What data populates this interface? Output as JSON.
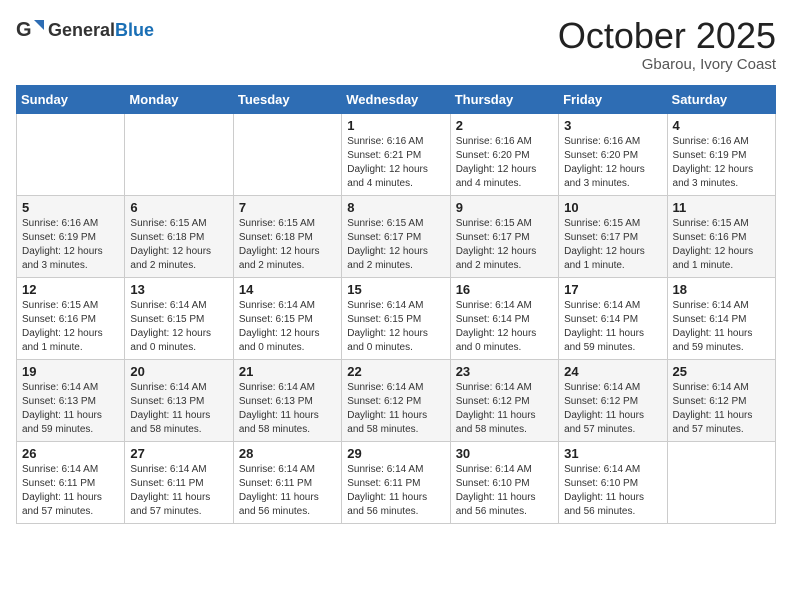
{
  "logo": {
    "general": "General",
    "blue": "Blue"
  },
  "title": "October 2025",
  "subtitle": "Gbarou, Ivory Coast",
  "days_of_week": [
    "Sunday",
    "Monday",
    "Tuesday",
    "Wednesday",
    "Thursday",
    "Friday",
    "Saturday"
  ],
  "weeks": [
    [
      null,
      null,
      null,
      {
        "day": 1,
        "sunrise": "6:16 AM",
        "sunset": "6:21 PM",
        "daylight": "12 hours and 4 minutes."
      },
      {
        "day": 2,
        "sunrise": "6:16 AM",
        "sunset": "6:20 PM",
        "daylight": "12 hours and 4 minutes."
      },
      {
        "day": 3,
        "sunrise": "6:16 AM",
        "sunset": "6:20 PM",
        "daylight": "12 hours and 3 minutes."
      },
      {
        "day": 4,
        "sunrise": "6:16 AM",
        "sunset": "6:19 PM",
        "daylight": "12 hours and 3 minutes."
      }
    ],
    [
      {
        "day": 5,
        "sunrise": "6:16 AM",
        "sunset": "6:19 PM",
        "daylight": "12 hours and 3 minutes."
      },
      {
        "day": 6,
        "sunrise": "6:15 AM",
        "sunset": "6:18 PM",
        "daylight": "12 hours and 2 minutes."
      },
      {
        "day": 7,
        "sunrise": "6:15 AM",
        "sunset": "6:18 PM",
        "daylight": "12 hours and 2 minutes."
      },
      {
        "day": 8,
        "sunrise": "6:15 AM",
        "sunset": "6:17 PM",
        "daylight": "12 hours and 2 minutes."
      },
      {
        "day": 9,
        "sunrise": "6:15 AM",
        "sunset": "6:17 PM",
        "daylight": "12 hours and 2 minutes."
      },
      {
        "day": 10,
        "sunrise": "6:15 AM",
        "sunset": "6:17 PM",
        "daylight": "12 hours and 1 minute."
      },
      {
        "day": 11,
        "sunrise": "6:15 AM",
        "sunset": "6:16 PM",
        "daylight": "12 hours and 1 minute."
      }
    ],
    [
      {
        "day": 12,
        "sunrise": "6:15 AM",
        "sunset": "6:16 PM",
        "daylight": "12 hours and 1 minute."
      },
      {
        "day": 13,
        "sunrise": "6:14 AM",
        "sunset": "6:15 PM",
        "daylight": "12 hours and 0 minutes."
      },
      {
        "day": 14,
        "sunrise": "6:14 AM",
        "sunset": "6:15 PM",
        "daylight": "12 hours and 0 minutes."
      },
      {
        "day": 15,
        "sunrise": "6:14 AM",
        "sunset": "6:15 PM",
        "daylight": "12 hours and 0 minutes."
      },
      {
        "day": 16,
        "sunrise": "6:14 AM",
        "sunset": "6:14 PM",
        "daylight": "12 hours and 0 minutes."
      },
      {
        "day": 17,
        "sunrise": "6:14 AM",
        "sunset": "6:14 PM",
        "daylight": "11 hours and 59 minutes."
      },
      {
        "day": 18,
        "sunrise": "6:14 AM",
        "sunset": "6:14 PM",
        "daylight": "11 hours and 59 minutes."
      }
    ],
    [
      {
        "day": 19,
        "sunrise": "6:14 AM",
        "sunset": "6:13 PM",
        "daylight": "11 hours and 59 minutes."
      },
      {
        "day": 20,
        "sunrise": "6:14 AM",
        "sunset": "6:13 PM",
        "daylight": "11 hours and 58 minutes."
      },
      {
        "day": 21,
        "sunrise": "6:14 AM",
        "sunset": "6:13 PM",
        "daylight": "11 hours and 58 minutes."
      },
      {
        "day": 22,
        "sunrise": "6:14 AM",
        "sunset": "6:12 PM",
        "daylight": "11 hours and 58 minutes."
      },
      {
        "day": 23,
        "sunrise": "6:14 AM",
        "sunset": "6:12 PM",
        "daylight": "11 hours and 58 minutes."
      },
      {
        "day": 24,
        "sunrise": "6:14 AM",
        "sunset": "6:12 PM",
        "daylight": "11 hours and 57 minutes."
      },
      {
        "day": 25,
        "sunrise": "6:14 AM",
        "sunset": "6:12 PM",
        "daylight": "11 hours and 57 minutes."
      }
    ],
    [
      {
        "day": 26,
        "sunrise": "6:14 AM",
        "sunset": "6:11 PM",
        "daylight": "11 hours and 57 minutes."
      },
      {
        "day": 27,
        "sunrise": "6:14 AM",
        "sunset": "6:11 PM",
        "daylight": "11 hours and 57 minutes."
      },
      {
        "day": 28,
        "sunrise": "6:14 AM",
        "sunset": "6:11 PM",
        "daylight": "11 hours and 56 minutes."
      },
      {
        "day": 29,
        "sunrise": "6:14 AM",
        "sunset": "6:11 PM",
        "daylight": "11 hours and 56 minutes."
      },
      {
        "day": 30,
        "sunrise": "6:14 AM",
        "sunset": "6:10 PM",
        "daylight": "11 hours and 56 minutes."
      },
      {
        "day": 31,
        "sunrise": "6:14 AM",
        "sunset": "6:10 PM",
        "daylight": "11 hours and 56 minutes."
      },
      null
    ]
  ]
}
